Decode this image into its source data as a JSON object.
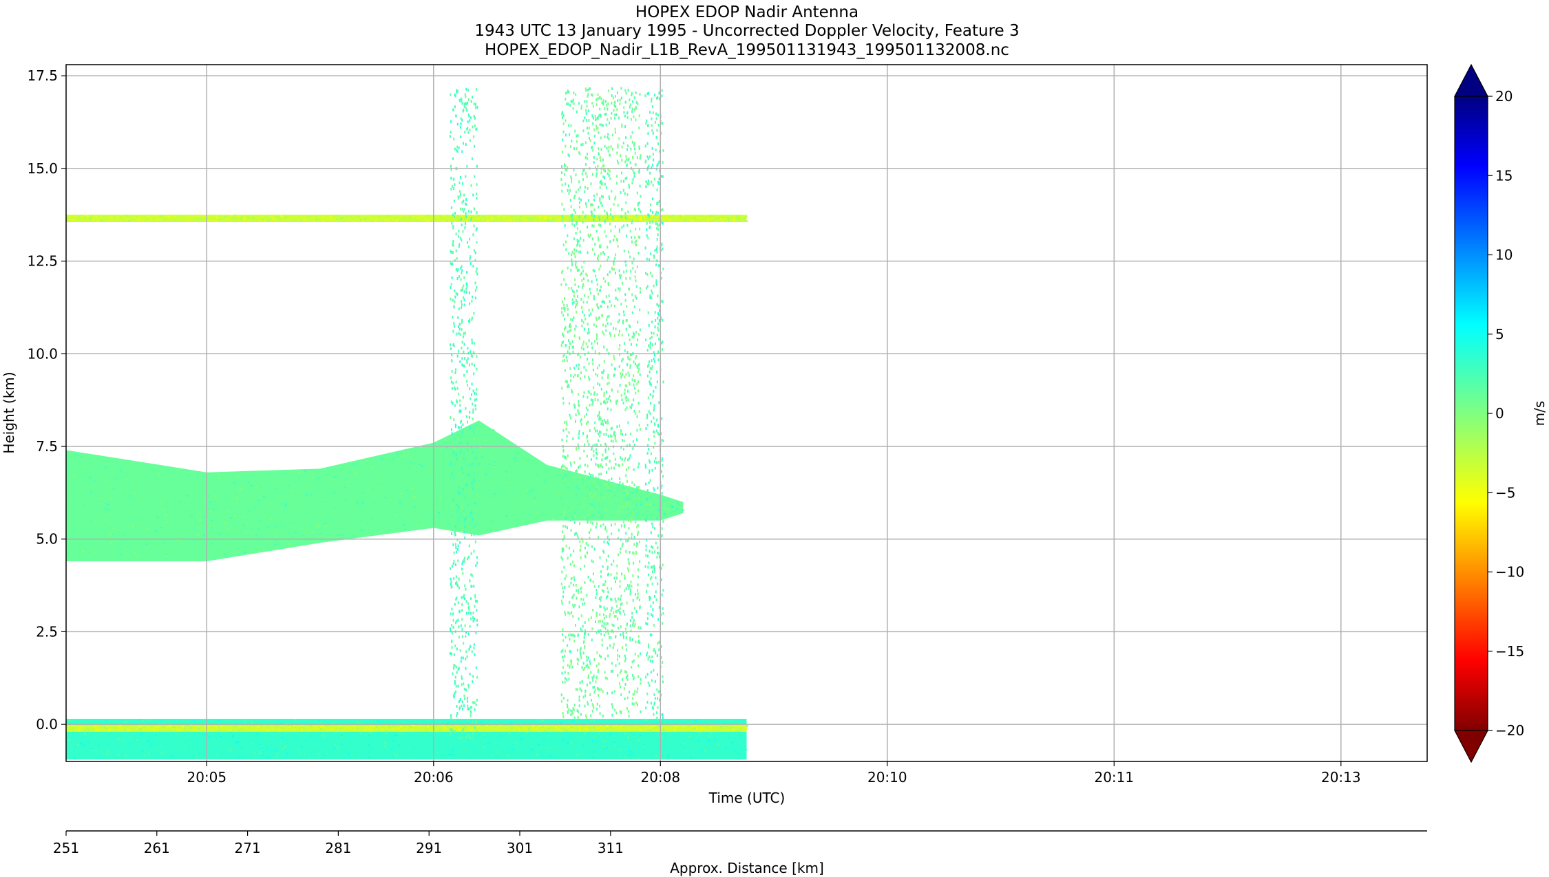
{
  "chart_data": {
    "type": "heatmap",
    "title_lines": [
      "HOPEX EDOP Nadir Antenna",
      "1943 UTC 13 January 1995 - Uncorrected Doppler Velocity, Feature 3",
      "HOPEX_EDOP_Nadir_L1B_RevA_199501131943_199501132008.nc"
    ],
    "xlabel": "Time (UTC)",
    "ylabel": "Height (km)",
    "x2label": "Approx. Distance [km]",
    "colorbar_label": "m/s",
    "colorbar_colormap": "jet",
    "colorbar_extend": "both",
    "grid": true,
    "xlim_minutes": [
      -0.62,
      5.38
    ],
    "ylim": [
      -1.0,
      17.8
    ],
    "x_ticks": [
      {
        "label": "20:05",
        "value": 0
      },
      {
        "label": "20:06",
        "value": 1
      },
      {
        "label": "20:08",
        "value": 2
      },
      {
        "label": "20:10",
        "value": 3
      },
      {
        "label": "20:11",
        "value": 4
      },
      {
        "label": "20:13",
        "value": 5
      }
    ],
    "y_ticks": [
      "0.0",
      "2.5",
      "5.0",
      "7.5",
      "10.0",
      "12.5",
      "15.0",
      "17.5"
    ],
    "y_tick_values": [
      0,
      2.5,
      5,
      7.5,
      10,
      12.5,
      15,
      17.5
    ],
    "distance_ticks": [
      {
        "label": "251",
        "value": 251
      },
      {
        "label": "261",
        "value": 261
      },
      {
        "label": "271",
        "value": 271
      },
      {
        "label": "281",
        "value": 281
      },
      {
        "label": "291",
        "value": 291
      },
      {
        "label": "301",
        "value": 301
      },
      {
        "label": "311",
        "value": 311
      }
    ],
    "distance_range": [
      251,
      401
    ],
    "colorbar_ticks": [
      "20",
      "15",
      "10",
      "5",
      "0",
      "−10",
      "−15",
      "−20",
      "−5"
    ],
    "colorbar_tick_values": [
      20,
      15,
      10,
      5,
      0,
      -10,
      -15,
      -20,
      -5
    ],
    "vmin": -20,
    "vmax": 20,
    "data_extent_minutes": [
      -0.62,
      2.38
    ],
    "features": [
      {
        "name": "surface echo",
        "kind": "band",
        "x": [
          -0.62,
          2.38
        ],
        "bottom": [
          -0.95,
          -0.95
        ],
        "top": [
          0.15,
          0.15
        ],
        "velocity": 3
      },
      {
        "name": "surface line",
        "kind": "band",
        "x": [
          -0.62,
          2.38
        ],
        "bottom": [
          -0.2,
          -0.2
        ],
        "top": [
          0.0,
          0.0
        ],
        "velocity": -3
      },
      {
        "name": "upper layer",
        "kind": "band",
        "x": [
          -0.62,
          2.38
        ],
        "bottom": [
          13.55,
          13.55
        ],
        "top": [
          13.75,
          13.75
        ],
        "velocity": -3
      },
      {
        "name": "cloud",
        "kind": "band",
        "x": [
          -0.62,
          0.0,
          0.5,
          1.0,
          1.2,
          1.5,
          2.0,
          2.1
        ],
        "bottom": [
          4.4,
          4.4,
          4.9,
          5.3,
          5.1,
          5.5,
          5.5,
          5.7
        ],
        "top": [
          7.4,
          6.8,
          6.9,
          7.6,
          8.2,
          7.0,
          6.2,
          6.0
        ],
        "velocity": 1
      },
      {
        "name": "noise column 1",
        "kind": "column",
        "x": [
          1.07,
          1.19
        ],
        "bottom": [
          -0.5,
          -0.5
        ],
        "top": [
          17.2,
          17.2
        ],
        "velocity": 2
      },
      {
        "name": "noise column 2",
        "kind": "column",
        "x": [
          1.56,
          1.91
        ],
        "bottom": [
          0.2,
          0.2
        ],
        "top": [
          17.2,
          17.2
        ],
        "velocity": 1
      },
      {
        "name": "noise column 3",
        "kind": "column",
        "x": [
          1.93,
          2.01
        ],
        "bottom": [
          0.2,
          0.2
        ],
        "top": [
          17.2,
          17.2
        ],
        "velocity": 2
      }
    ]
  }
}
